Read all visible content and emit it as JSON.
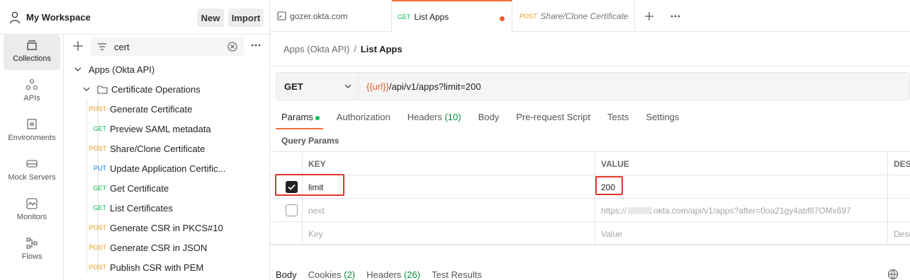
{
  "workspace": {
    "title": "My Workspace",
    "new_label": "New",
    "import_label": "Import"
  },
  "rail": [
    {
      "label": "Collections",
      "icon": "collections-icon"
    },
    {
      "label": "APIs",
      "icon": "apis-icon"
    },
    {
      "label": "Environments",
      "icon": "environments-icon"
    },
    {
      "label": "Mock Servers",
      "icon": "mock-servers-icon"
    },
    {
      "label": "Monitors",
      "icon": "monitors-icon"
    },
    {
      "label": "Flows",
      "icon": "flows-icon"
    }
  ],
  "search": {
    "value": "cert"
  },
  "tree": {
    "collection": "Apps (Okta API)",
    "folder": "Certificate Operations",
    "requests": [
      {
        "method": "POST",
        "name": "Generate Certificate"
      },
      {
        "method": "GET",
        "name": "Preview SAML metadata"
      },
      {
        "method": "POST",
        "name": "Share/Clone Certificate"
      },
      {
        "method": "PUT",
        "name": "Update Application Certific..."
      },
      {
        "method": "GET",
        "name": "Get Certificate"
      },
      {
        "method": "GET",
        "name": "List Certificates"
      },
      {
        "method": "POST",
        "name": "Generate CSR in PKCS#10"
      },
      {
        "method": "POST",
        "name": "Generate CSR in JSON"
      },
      {
        "method": "POST",
        "name": "Publish CSR with PEM"
      }
    ]
  },
  "tabs": [
    {
      "method": "",
      "label": "gozer.okta.com"
    },
    {
      "method": "GET",
      "label": "List Apps"
    },
    {
      "method": "POST",
      "label": "Share/Clone Certificate"
    }
  ],
  "breadcrumb": {
    "parent": "Apps (Okta API)",
    "sep": "/",
    "current": "List Apps"
  },
  "request": {
    "method": "GET",
    "url_var": "{{url}}",
    "url_path": "/api/v1/apps?limit=200"
  },
  "req_tabs": {
    "params": "Params",
    "authorization": "Authorization",
    "headers": "Headers",
    "headers_count": "(10)",
    "body": "Body",
    "prerequest": "Pre-request Script",
    "tests": "Tests",
    "settings": "Settings"
  },
  "query_params": {
    "title": "Query Params",
    "col_key": "KEY",
    "col_value": "VALUE",
    "col_desc": "DES",
    "rows": [
      {
        "checked": true,
        "key": "limit",
        "value": "200"
      },
      {
        "checked": false,
        "key": "next",
        "value_prefix": "https://",
        "value_suffix": "okta.com/api/v1/apps?after=0oa21gy4abfIl7OMx697"
      }
    ],
    "placeholder_key": "Key",
    "placeholder_value": "Value",
    "placeholder_desc": "Desc"
  },
  "response_tabs": {
    "body": "Body",
    "cookies": "Cookies",
    "cookies_count": "(2)",
    "headers": "Headers",
    "headers_count": "(26)",
    "test_results": "Test Results"
  },
  "colors": {
    "accent": "#ff6c37",
    "post": "#ed9a13",
    "get": "#0cbb52",
    "put": "#097bed",
    "highlight": "#e0352b"
  }
}
